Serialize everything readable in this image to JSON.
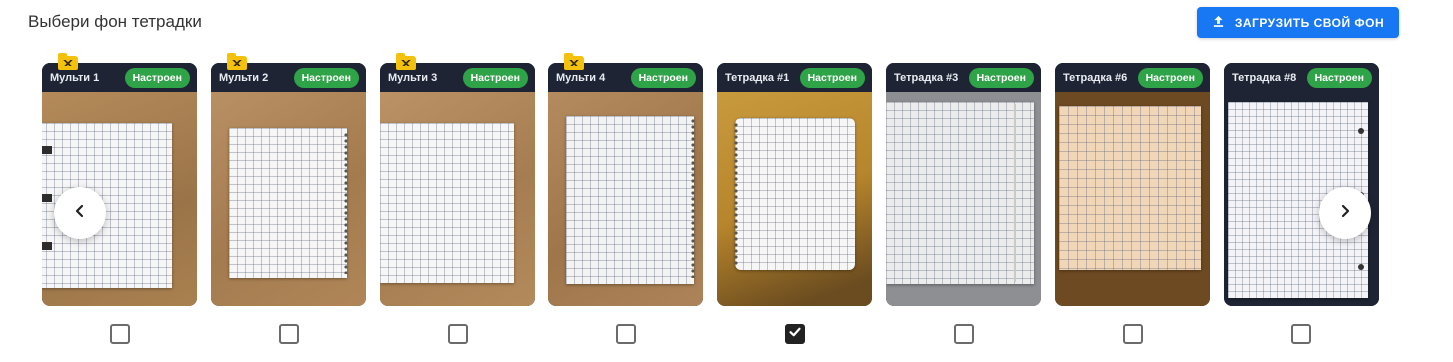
{
  "header": {
    "title": "Выбери фон тетрадки",
    "upload_button_label": "ЗАГРУЗИТЬ СВОЙ ФОН",
    "upload_icon": "upload-icon"
  },
  "colors": {
    "accent": "#1877f2",
    "badge_green": "#2fa347",
    "card_header": "#1e2433",
    "folder_tag": "#f4c20d"
  },
  "carousel": {
    "prev_icon": "chevron-left-icon",
    "next_icon": "chevron-right-icon",
    "items": [
      {
        "label": "Мульти 1",
        "badge": "Настроен",
        "folder": true,
        "checked": false
      },
      {
        "label": "Мульти 2",
        "badge": "Настроен",
        "folder": true,
        "checked": false
      },
      {
        "label": "Мульти 3",
        "badge": "Настроен",
        "folder": true,
        "checked": false
      },
      {
        "label": "Мульти 4",
        "badge": "Настроен",
        "folder": true,
        "checked": false
      },
      {
        "label": "Тетрадка #1",
        "badge": "Настроен",
        "folder": false,
        "checked": true
      },
      {
        "label": "Тетрадка #3",
        "badge": "Настроен",
        "folder": false,
        "checked": false
      },
      {
        "label": "Тетрадка #6",
        "badge": "Настроен",
        "folder": false,
        "checked": false
      },
      {
        "label": "Тетрадка #8",
        "badge": "Настроен",
        "folder": false,
        "checked": false
      }
    ]
  }
}
